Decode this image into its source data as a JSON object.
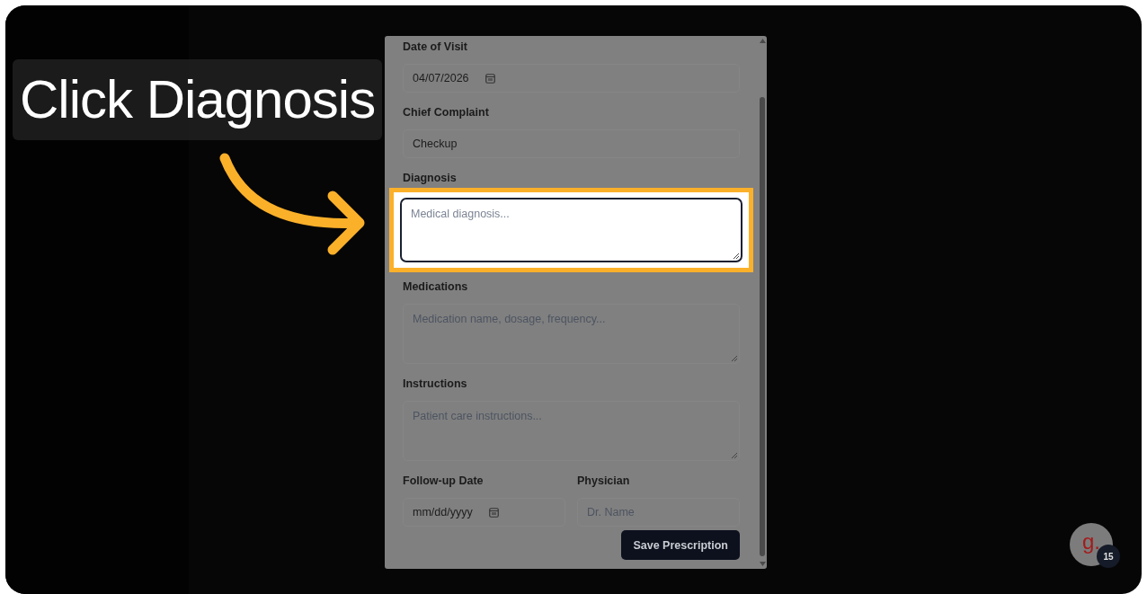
{
  "callout": {
    "text": "Click Diagnosis"
  },
  "form": {
    "rows": [
      {
        "fields": [
          {
            "label": "Date of Visit",
            "kind": "date",
            "value": "04/07/2026",
            "highlighted": false
          }
        ]
      },
      {
        "fields": [
          {
            "label": "Chief Complaint",
            "kind": "text",
            "value": "Checkup",
            "highlighted": false
          }
        ]
      },
      {
        "fields": [
          {
            "label": "Diagnosis",
            "kind": "textarea",
            "placeholder": "Medical diagnosis...",
            "highlighted": true
          }
        ]
      },
      {
        "fields": [
          {
            "label": "Medications",
            "kind": "textarea",
            "placeholder": "Medication name, dosage, frequency...",
            "highlighted": false
          }
        ]
      },
      {
        "fields": [
          {
            "label": "Instructions",
            "kind": "textarea",
            "placeholder": "Patient care instructions...",
            "highlighted": false
          }
        ]
      },
      {
        "fields": [
          {
            "label": "Follow-up Date",
            "kind": "date",
            "value": "mm/dd/yyyy",
            "highlighted": false
          },
          {
            "label": "Physician",
            "kind": "text",
            "placeholder": "Dr. Name",
            "highlighted": false
          }
        ]
      }
    ],
    "submit": "Save Prescription"
  },
  "chat_widget": {
    "logo": "g.",
    "count": "15"
  }
}
